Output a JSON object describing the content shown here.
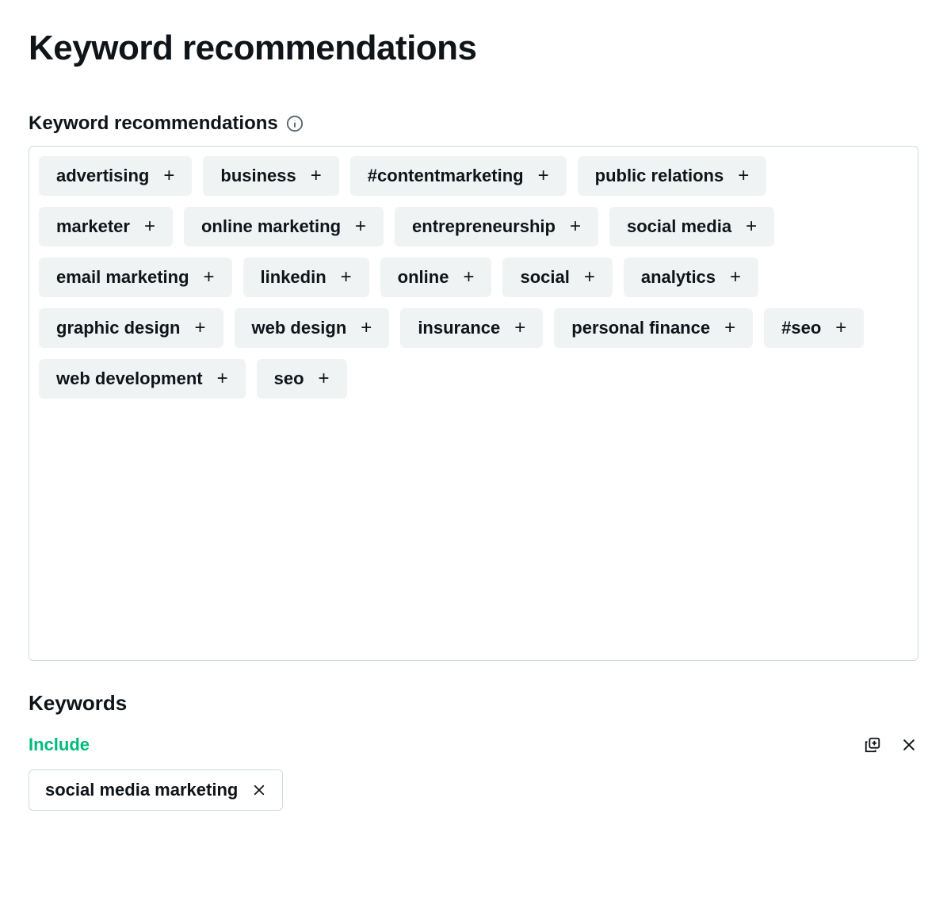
{
  "page": {
    "title": "Keyword recommendations"
  },
  "recommendations": {
    "header": "Keyword recommendations",
    "items": [
      "advertising",
      "business",
      "#contentmarketing",
      "public relations",
      "marketer",
      "online marketing",
      "entrepreneurship",
      "social media",
      "email marketing",
      "linkedin",
      "online",
      "social",
      "analytics",
      "graphic design",
      "web design",
      "insurance",
      "personal finance",
      "#seo",
      "web development",
      "seo"
    ]
  },
  "keywords": {
    "header": "Keywords",
    "include_label": "Include",
    "included": [
      "social media marketing"
    ]
  }
}
